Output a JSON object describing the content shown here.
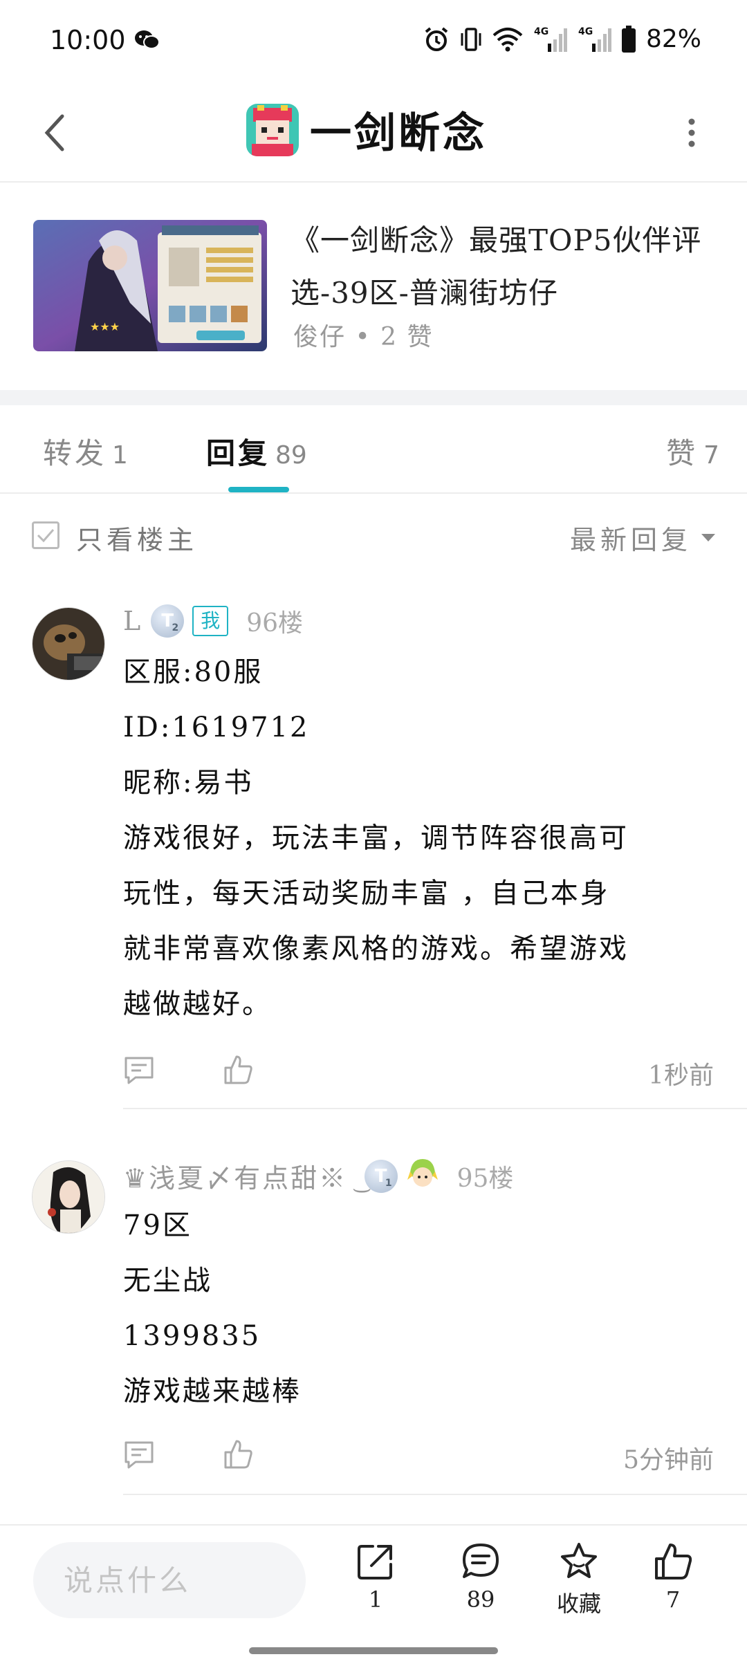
{
  "status_bar": {
    "time": "10:00",
    "network_1": "4G",
    "network_2": "4G",
    "battery": "82%"
  },
  "header": {
    "title": "一剑断念"
  },
  "article": {
    "title_line1": "《一剑断念》最强TOP5伙伴评",
    "title_line2": "选-39区-普澜街坊仔",
    "meta": "俊仔 • 2 赞"
  },
  "tabs": [
    {
      "label": "转发",
      "count": "1"
    },
    {
      "label": "回复",
      "count": "89"
    },
    {
      "label": "赞",
      "count": "7"
    }
  ],
  "filter": {
    "only_author_label": "只看楼主",
    "sort_label": "最新回复"
  },
  "comments": [
    {
      "username": "L",
      "level_badge": "T",
      "level_sub": "2",
      "me_badge": "我",
      "floor": "96楼",
      "lines": [
        "区服:80服",
        "ID:1619712",
        "昵称:易书",
        "游戏很好，玩法丰富，调节阵容很高可",
        "玩性，每天活动奖励丰富 ，自己本身",
        "就非常喜欢像素风格的游戏。希望游戏",
        "越做越好。"
      ],
      "time": "1秒前"
    },
    {
      "username": "♛浅夏〆有点甜※ ͜",
      "level_badge": "T",
      "level_sub": "1",
      "floor": "95楼",
      "lines": [
        "79区",
        "无尘战",
        "1399835",
        "游戏越来越棒"
      ],
      "time": "5分钟前"
    }
  ],
  "bottom_bar": {
    "input_placeholder": "说点什么",
    "share_count": "1",
    "reply_count": "89",
    "favorite_label": "收藏",
    "like_count": "7"
  },
  "colors": {
    "accent": "#1fb3c4",
    "muted": "#999999"
  }
}
